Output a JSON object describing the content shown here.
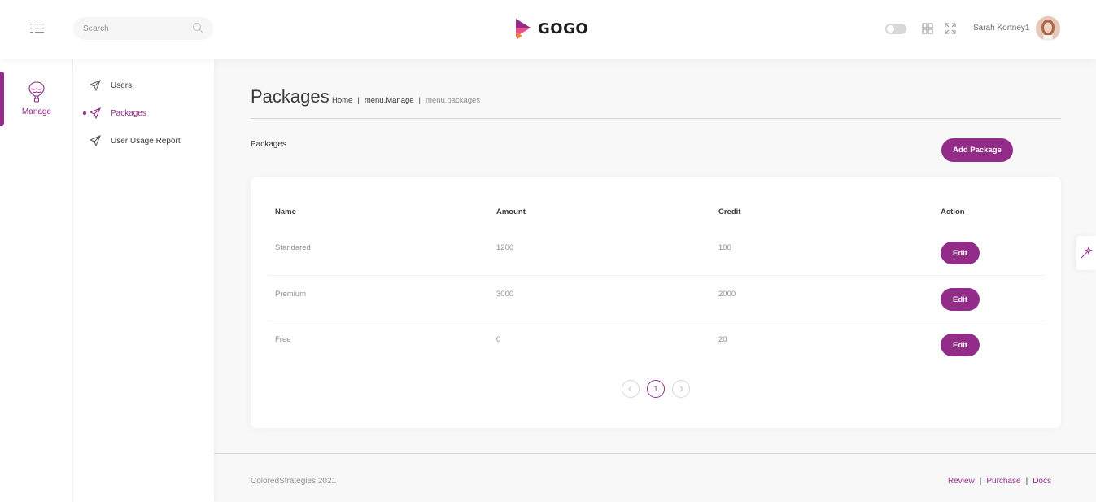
{
  "header": {
    "search_placeholder": "Search",
    "brand": "GOGO",
    "username": "Sarah Kortney1",
    "icons": [
      "menu-icon",
      "search-icon",
      "logo-icon",
      "theme-toggle",
      "grid-icon",
      "fullscreen-icon",
      "avatar"
    ]
  },
  "main_menu": {
    "items": [
      {
        "label": "Manage",
        "icon": "hot-air-balloon-icon",
        "active": true
      }
    ]
  },
  "sub_menu": {
    "items": [
      {
        "label": "Users",
        "icon": "paper-plane-icon"
      },
      {
        "label": "Packages",
        "icon": "paper-plane-icon",
        "active": true
      },
      {
        "label": "User Usage Report",
        "icon": "paper-plane-icon"
      }
    ]
  },
  "page": {
    "title": "Packages",
    "breadcrumb": [
      "Home",
      "menu.Manage",
      "menu.packages"
    ],
    "section_label": "Packages",
    "add_button": "Add Package"
  },
  "table": {
    "columns": [
      "Name",
      "Amount",
      "Credit",
      "Action"
    ],
    "rows": [
      {
        "name": "Standared",
        "amount": "1200",
        "credit": "100",
        "action": "Edit"
      },
      {
        "name": "Premium",
        "amount": "3000",
        "credit": "2000",
        "action": "Edit"
      },
      {
        "name": "Free",
        "amount": "0",
        "credit": "20",
        "action": "Edit"
      }
    ],
    "pagination": {
      "current_page": "1"
    }
  },
  "footer": {
    "copyright": "ColoredStrategies 2021",
    "links": [
      "Review",
      "Purchase",
      "Docs"
    ]
  },
  "colors": {
    "accent": "#922c88",
    "background": "#f8f8f8",
    "text": "#3a3a3a",
    "muted": "#8f8f8f"
  }
}
